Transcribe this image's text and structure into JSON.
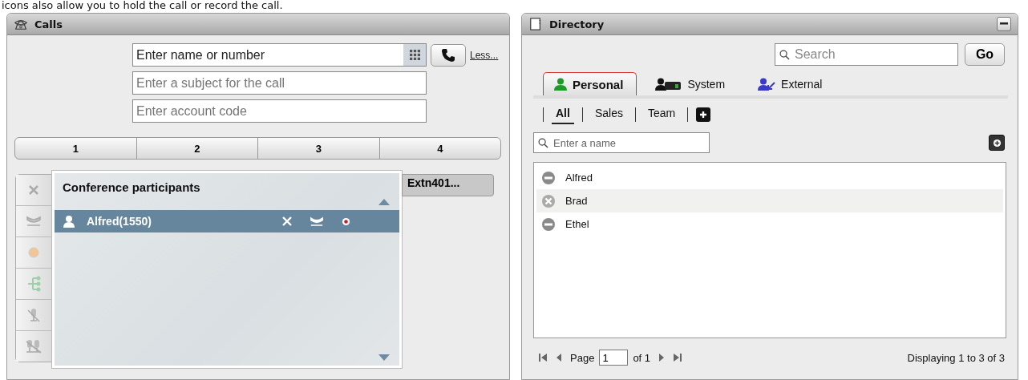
{
  "caption": "icons also allow you to hold the call or record the call.",
  "calls": {
    "title": "Calls",
    "number_field": {
      "placeholder": "Enter name or number"
    },
    "subject_field": {
      "placeholder": "Enter a subject for the call"
    },
    "account_field": {
      "placeholder": "Enter account code"
    },
    "less_link": "Less...",
    "line_tabs": [
      "1",
      "2",
      "3",
      "4"
    ],
    "conference": {
      "title": "Conference participants",
      "participants": [
        {
          "name": "Alfred(1550)",
          "selected": true
        }
      ]
    },
    "call_tab": "Extn401..."
  },
  "directory": {
    "title": "Directory",
    "search": {
      "placeholder": "Search"
    },
    "go_button": "Go",
    "tabs": [
      {
        "label": "Personal",
        "kind": "personal",
        "selected": true
      },
      {
        "label": "System",
        "kind": "system",
        "selected": false
      },
      {
        "label": "External",
        "kind": "external",
        "selected": false
      }
    ],
    "groups": [
      {
        "label": "All",
        "selected": true
      },
      {
        "label": "Sales",
        "selected": false
      },
      {
        "label": "Team",
        "selected": false
      }
    ],
    "name_filter": {
      "placeholder": "Enter a name"
    },
    "contacts": [
      {
        "name": "Alfred",
        "kind": "busy",
        "selected": false
      },
      {
        "name": "Brad",
        "kind": "offline",
        "selected": true
      },
      {
        "name": "Ethel",
        "kind": "busy",
        "selected": false
      }
    ],
    "pager": {
      "page_label": "Page",
      "page": "1",
      "of": "of 1",
      "summary": "Displaying 1 to 3 of 3"
    }
  }
}
